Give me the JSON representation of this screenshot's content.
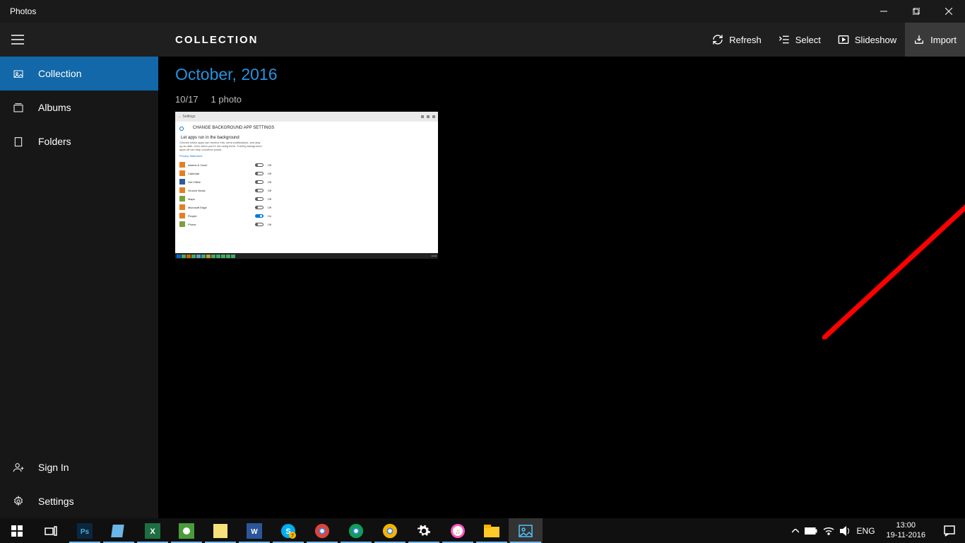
{
  "titlebar": {
    "app_name": "Photos"
  },
  "toolbar": {
    "section": "COLLECTION",
    "refresh": "Refresh",
    "select": "Select",
    "slideshow": "Slideshow",
    "import": "Import"
  },
  "sidebar": {
    "items": [
      {
        "label": "Collection"
      },
      {
        "label": "Albums"
      },
      {
        "label": "Folders"
      }
    ],
    "signin": "Sign In",
    "settings": "Settings"
  },
  "content": {
    "month": "October, 2016",
    "day": "10/17",
    "count": "1 photo",
    "thumb": {
      "breadcrumb": "CHANGE BACKGROUND APP SETTINGS",
      "heading": "Let apps run in the background",
      "desc": "Choose which apps can receive info, send notifications, and stay up-to-date, even when you're not using them. Turning background apps off can help conserve power.",
      "link": "Privacy Statement",
      "rows": [
        {
          "name": "Alarms & Clock",
          "state": "Off"
        },
        {
          "name": "Calendar",
          "state": "Off"
        },
        {
          "name": "Get Office",
          "state": "Off"
        },
        {
          "name": "Groove Music",
          "state": "Off"
        },
        {
          "name": "Maps",
          "state": "Off"
        },
        {
          "name": "Microsoft Edge",
          "state": "Off"
        },
        {
          "name": "People",
          "state": "On"
        },
        {
          "name": "Phone",
          "state": "Off"
        }
      ]
    }
  },
  "tray": {
    "lang": "ENG",
    "time": "13:00",
    "date": "19-11-2016"
  }
}
